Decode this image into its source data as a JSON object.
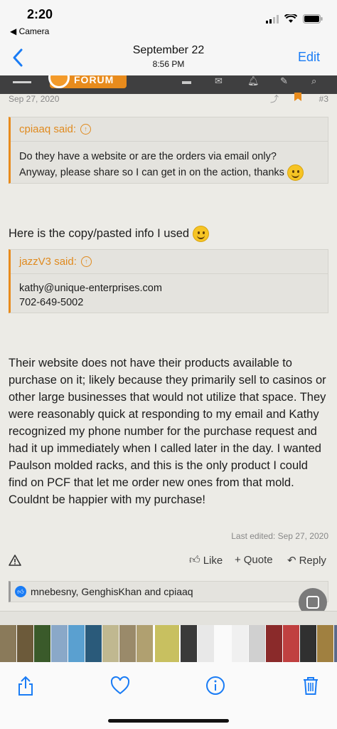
{
  "status_bar": {
    "time": "2:20",
    "back_app": "◀ Camera"
  },
  "nav": {
    "title": "September 22",
    "subtitle": "8:56 PM",
    "edit_label": "Edit"
  },
  "forum": {
    "logo_text": "FORUM"
  },
  "post": {
    "date": "Sep 27, 2020",
    "post_number": "#3",
    "quote1": {
      "author": "cpiaaq said:",
      "line1": "Do they have a website or are the orders via email only?",
      "line2": "Anyway, please share so I can get in on the action, thanks"
    },
    "intro": "Here is the copy/pasted info I used",
    "quote2": {
      "author": "jazzV3 said:",
      "line1": "kathy@unique-enterprises.com",
      "line2": "702-649-5002"
    },
    "body": "Their website does not have their products available to purchase on it; likely because they primarily sell to casinos or other large businesses that would not utilize that space. They were reasonably quick at responding to my email and Kathy recognized my phone number for the purchase request and had it up immediately when I called later in the day. I wanted Paulson molded racks, and this is the only product I could find on PCF that let me order new ones from that mold. Couldnt be happier with my purchase!",
    "last_edited": "Last edited: Sep 27, 2020",
    "actions": {
      "like": "Like",
      "quote": "Quote",
      "reply": "Reply"
    },
    "likes": "mnebesny, GenghisKhan and cpiaaq"
  },
  "colors": {
    "accent": "#e88b1c",
    "ios_blue": "#1a7cf5"
  },
  "thumbnail_colors": [
    "#8a7a5a",
    "#6c5a3a",
    "#3a5a2a",
    "#8aa8c8",
    "#5aa0d0",
    "#2a5a7a",
    "#c0b890",
    "#9a8a6a",
    "#b0a070",
    "#c8c060",
    "#3a3a3a",
    "#e8e8e8",
    "#fafafa",
    "#f0f0f0",
    "#d0d0d0",
    "#8a2a2a",
    "#c04040",
    "#303030",
    "#a08040",
    "#5a6a8a",
    "#c0a030",
    "#7a8a4a",
    "#4a5a3a",
    "#e8e8e8",
    "#6a7a5a",
    "#4a6a3a",
    "#5a5a4a",
    "#7a8a6a",
    "#2a3a2a",
    "#9aa08a",
    "#c8c8c0"
  ]
}
